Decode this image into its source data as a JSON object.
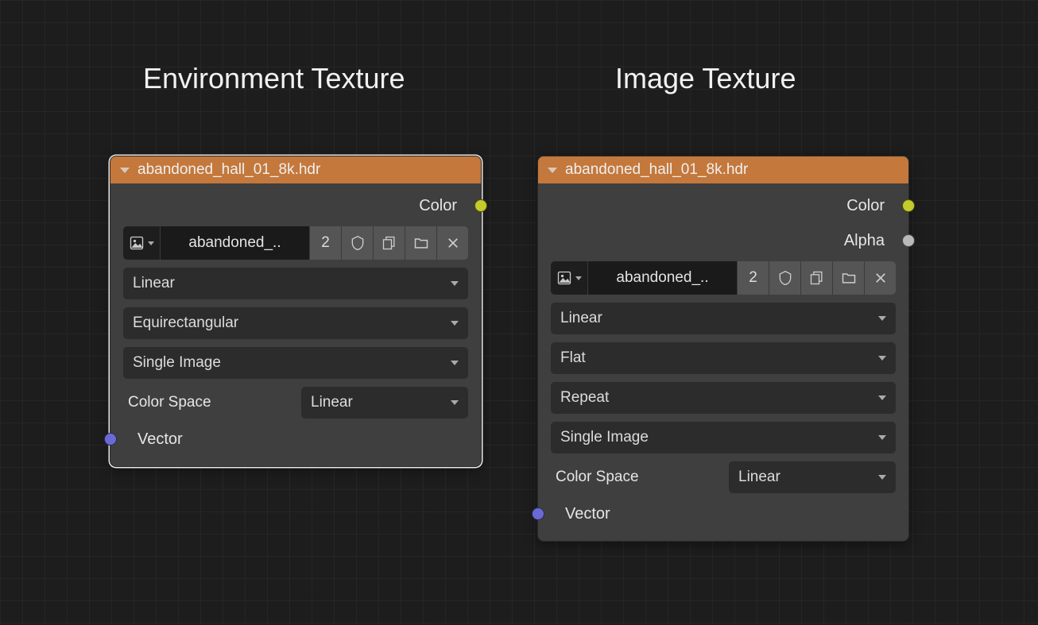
{
  "headings": {
    "left": "Environment Texture",
    "right": "Image Texture"
  },
  "colors": {
    "color_socket": "#c3cc2b",
    "alpha_socket": "#b9b9b9",
    "vector_socket": "#6a6ad6"
  },
  "node_left": {
    "title": "abandoned_hall_01_8k.hdr",
    "image_name": "abandoned_..",
    "user_count": "2",
    "interpolation": "Linear",
    "projection": "Equirectangular",
    "source": "Single Image",
    "color_space_label": "Color Space",
    "color_space_value": "Linear",
    "out_color": "Color",
    "in_vector": "Vector"
  },
  "node_right": {
    "title": "abandoned_hall_01_8k.hdr",
    "image_name": "abandoned_..",
    "user_count": "2",
    "interpolation": "Linear",
    "projection": "Flat",
    "extension": "Repeat",
    "source": "Single Image",
    "color_space_label": "Color Space",
    "color_space_value": "Linear",
    "out_color": "Color",
    "out_alpha": "Alpha",
    "in_vector": "Vector"
  }
}
